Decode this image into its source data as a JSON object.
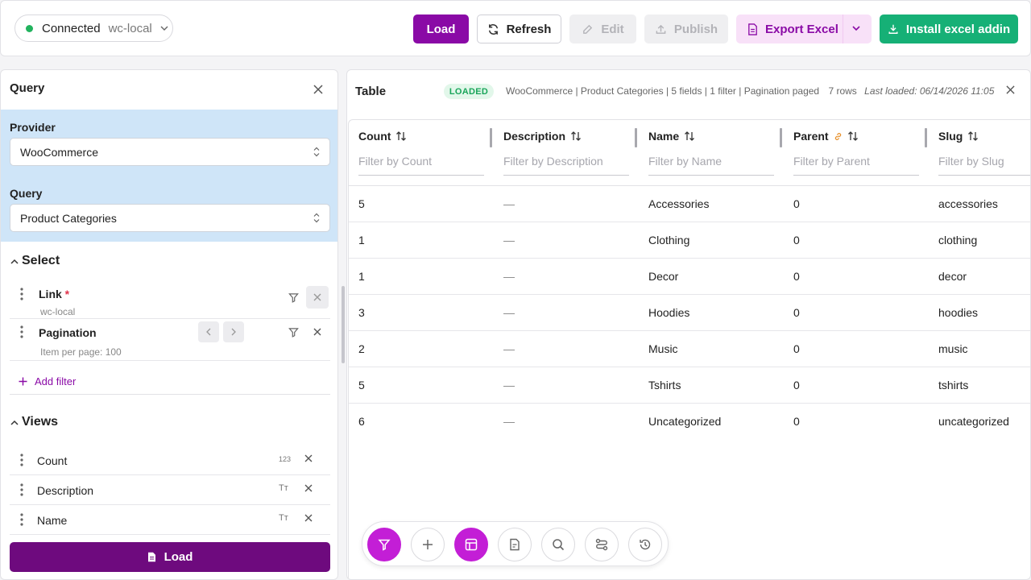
{
  "topbar": {
    "connection": {
      "status": "Connected",
      "env": "wc-local",
      "status_color": "#22b35e"
    },
    "buttons": {
      "load": "Load",
      "refresh": "Refresh",
      "edit": "Edit",
      "publish": "Publish",
      "export": "Export Excel",
      "install": "Install excel addin"
    }
  },
  "query_panel": {
    "title": "Query",
    "provider_label": "Provider",
    "provider_value": "WooCommerce",
    "query_label": "Query",
    "query_value": "Product Categories",
    "select_title": "Select",
    "filters": [
      {
        "name": "Link",
        "required": "*",
        "sub": "wc-local"
      },
      {
        "name": "Pagination",
        "sub": "Item per page: 100"
      }
    ],
    "add_filter": "Add filter",
    "views_title": "Views",
    "views": [
      {
        "name": "Count",
        "type": "123"
      },
      {
        "name": "Description",
        "type": "Tт"
      },
      {
        "name": "Name",
        "type": "Tт"
      }
    ],
    "load_button": "Load"
  },
  "table_panel": {
    "title": "Table",
    "badge": "LOADED",
    "meta": "WooCommerce | Product Categories | 5 fields | 1 filter | Pagination paged",
    "rows_count": "7 rows",
    "last_loaded": "Last loaded: 06/14/2026 11:05",
    "columns": [
      {
        "name": "Count",
        "filter": "Filter by Count"
      },
      {
        "name": "Description",
        "filter": "Filter by Description"
      },
      {
        "name": "Name",
        "filter": "Filter by Name"
      },
      {
        "name": "Parent",
        "filter": "Filter by Parent"
      },
      {
        "name": "Slug",
        "filter": "Filter by Slug"
      }
    ],
    "rows": [
      {
        "count": "5",
        "description": "—",
        "name": "Accessories",
        "parent": "0",
        "slug": "accessories"
      },
      {
        "count": "1",
        "description": "—",
        "name": "Clothing",
        "parent": "0",
        "slug": "clothing"
      },
      {
        "count": "1",
        "description": "—",
        "name": "Decor",
        "parent": "0",
        "slug": "decor"
      },
      {
        "count": "3",
        "description": "—",
        "name": "Hoodies",
        "parent": "0",
        "slug": "hoodies"
      },
      {
        "count": "2",
        "description": "—",
        "name": "Music",
        "parent": "0",
        "slug": "music"
      },
      {
        "count": "5",
        "description": "—",
        "name": "Tshirts",
        "parent": "0",
        "slug": "tshirts"
      },
      {
        "count": "6",
        "description": "—",
        "name": "Uncategorized",
        "parent": "0",
        "slug": "uncategorized"
      }
    ]
  },
  "toolbar_icons": [
    "filter-icon",
    "plus-icon",
    "table-icon",
    "report-icon",
    "search-icon",
    "workflow-icon",
    "history-icon"
  ],
  "colors": {
    "accent": "#8a0aa6",
    "install": "#16b076",
    "active_fab": "#c31ed6",
    "panel_blue": "#cfe5f8"
  }
}
